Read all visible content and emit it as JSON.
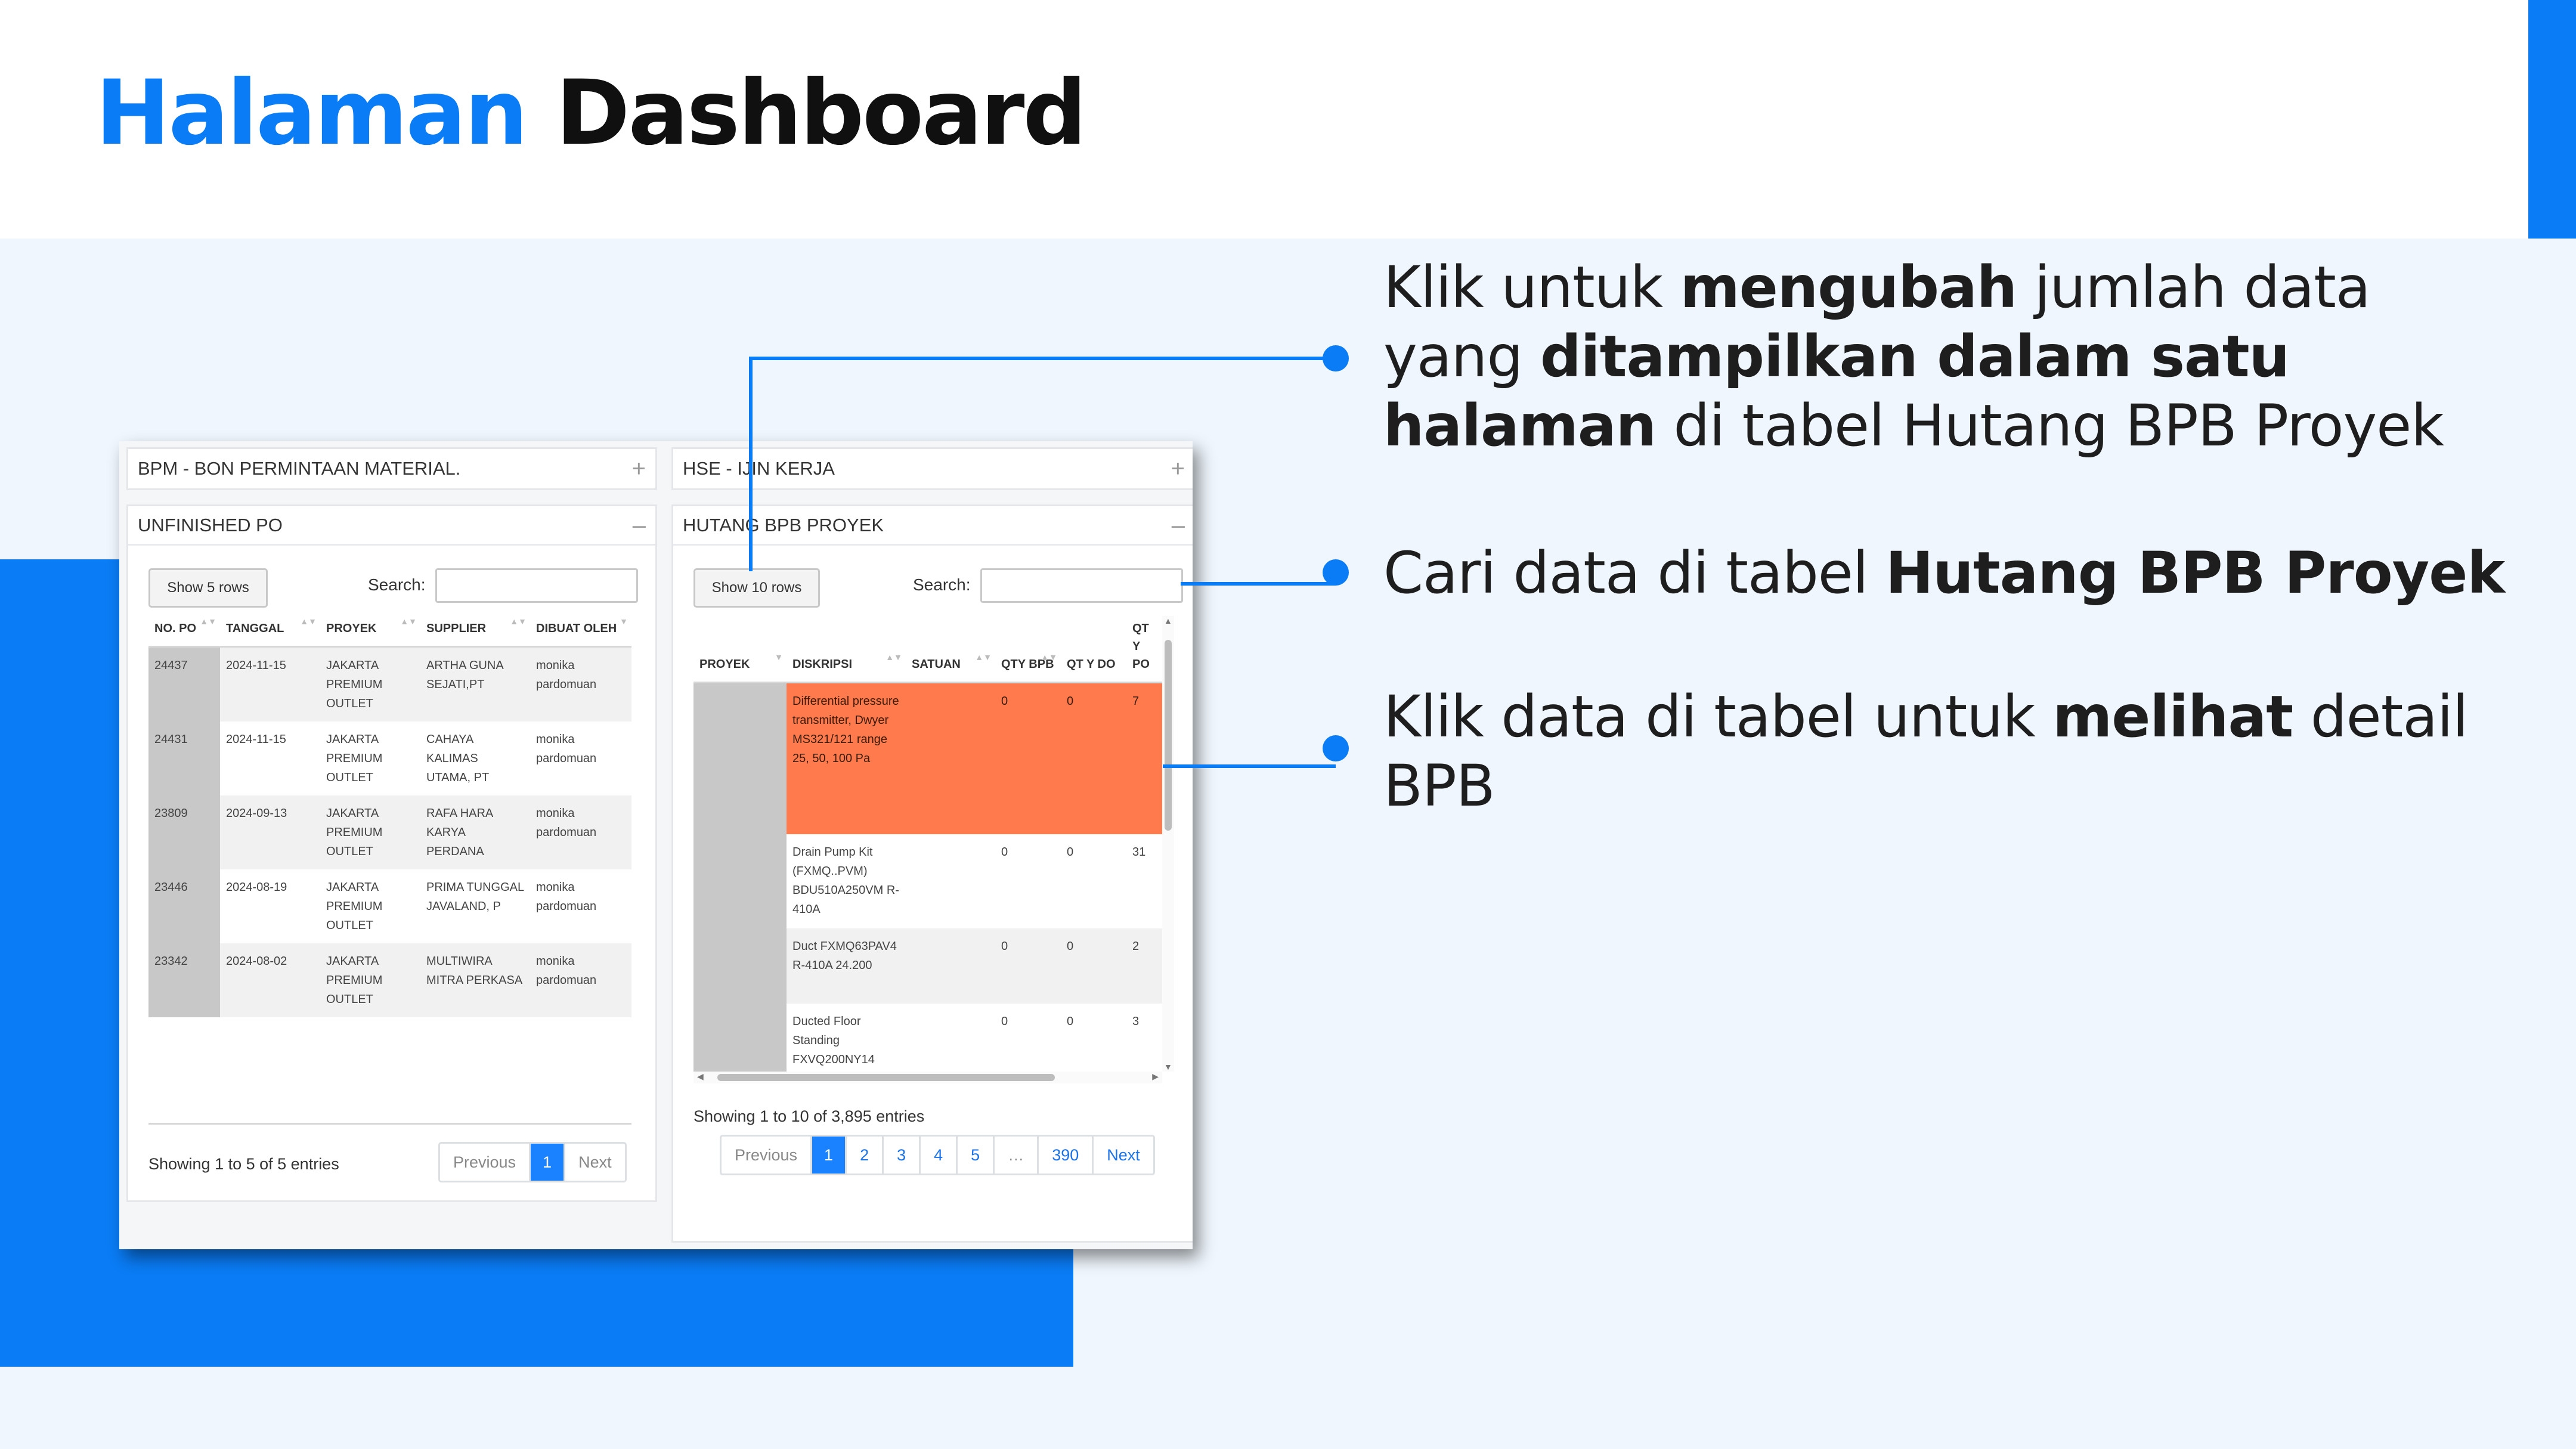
{
  "title": {
    "part1": "Halaman",
    "part2": "Dashboard"
  },
  "colors": {
    "accent": "#0a7cf5",
    "highlight_row": "#ff7b4d",
    "background": "#eff6fd"
  },
  "screenshot": {
    "bpm_panel": {
      "title": "BPM - BON PERMINTAAN MATERIAL.",
      "toggle": "+"
    },
    "hse_panel": {
      "title": "HSE - IJIN KERJA",
      "toggle": "+"
    },
    "unfinished_po": {
      "title": "UNFINISHED PO",
      "toggle": "–",
      "show_rows_label": "Show 5 rows",
      "search_label": "Search:",
      "search_value": "",
      "columns": [
        "NO. PO",
        "TANGGAL",
        "PROYEK",
        "SUPPLIER",
        "DIBUAT OLEH"
      ],
      "rows": [
        [
          "24437",
          "2024-11-15",
          "JAKARTA PREMIUM OUTLET",
          "ARTHA GUNA SEJATI,PT",
          "monika pardomuan"
        ],
        [
          "24431",
          "2024-11-15",
          "JAKARTA PREMIUM OUTLET",
          "CAHAYA KALIMAS UTAMA, PT",
          "monika pardomuan"
        ],
        [
          "23809",
          "2024-09-13",
          "JAKARTA PREMIUM OUTLET",
          "RAFA HARA KARYA PERDANA",
          "monika pardomuan"
        ],
        [
          "23446",
          "2024-08-19",
          "JAKARTA PREMIUM OUTLET",
          "PRIMA TUNGGAL JAVALAND, P",
          "monika pardomuan"
        ],
        [
          "23342",
          "2024-08-02",
          "JAKARTA PREMIUM OUTLET",
          "MULTIWIRA MITRA PERKASA",
          "monika pardomuan"
        ]
      ],
      "info": "Showing 1 to 5 of 5 entries",
      "pagination": {
        "previous": "Previous",
        "pages": [
          "1"
        ],
        "next": "Next"
      }
    },
    "hutang_bpb": {
      "title": "HUTANG BPB PROYEK",
      "toggle": "–",
      "show_rows_label": "Show 10 rows",
      "search_label": "Search:",
      "search_value": "",
      "columns": [
        "PROYEK",
        "DISKRIPSI",
        "SATUAN",
        "QTY BPB",
        "QT Y DO",
        "QT Y PO"
      ],
      "rows": [
        [
          "",
          "Differential pressure transmitter, Dwyer MS321/121 range 25, 50, 100 Pa",
          "",
          "0",
          "0",
          "7"
        ],
        [
          "",
          "Drain Pump Kit (FXMQ..PVM) BDU510A250VM R-410A",
          "",
          "0",
          "0",
          "31"
        ],
        [
          "",
          "Duct FXMQ63PAV4 R-410A 24.200",
          "",
          "0",
          "0",
          "2"
        ],
        [
          "",
          "Ducted Floor Standing FXVQ200NY14",
          "",
          "0",
          "0",
          "3"
        ]
      ],
      "info": "Showing 1 to 10 of 3,895 entries",
      "pagination": {
        "previous": "Previous",
        "pages": [
          "1",
          "2",
          "3",
          "4",
          "5",
          "…",
          "390"
        ],
        "next": "Next"
      }
    }
  },
  "annotations": [
    {
      "t1": "Klik untuk ",
      "b1": "mengubah",
      "t2": " jumlah data yang ",
      "b2": "ditampilkan dalam satu halaman",
      "t3": " di tabel Hutang BPB Proyek"
    },
    {
      "t1": "Cari data di tabel ",
      "b1": "Hutang BPB Proyek"
    },
    {
      "t1": "Klik data di tabel untuk ",
      "b1": "melihat",
      "t2": " detail BPB"
    }
  ]
}
